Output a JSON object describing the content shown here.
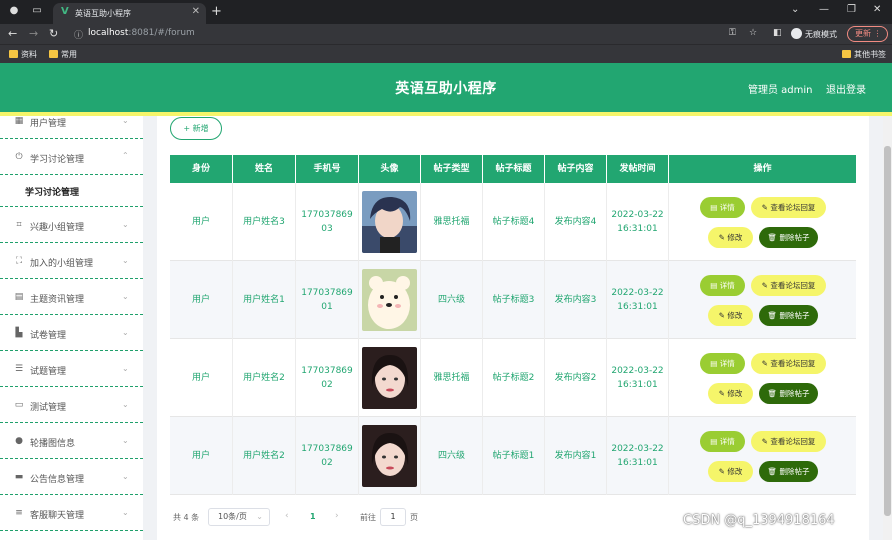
{
  "browser": {
    "tab_title": "英语互助小程序",
    "url_host": "localhost",
    "url_rest": ":8081/#/forum",
    "incognito_label": "无痕模式",
    "update_label": "更新",
    "bookmarks": [
      "资料",
      "常用"
    ],
    "other_bookmarks": "其他书签"
  },
  "header": {
    "title": "英语互助小程序",
    "admin": "管理员 admin",
    "logout": "退出登录"
  },
  "sidebar": {
    "items": [
      {
        "label": "用户管理",
        "icon": "grid-icon"
      },
      {
        "label": "学习讨论管理",
        "icon": "power-icon",
        "expanded": true
      },
      {
        "label": "兴趣小组管理",
        "icon": "crop-icon"
      },
      {
        "label": "加入的小组管理",
        "icon": "frame-icon"
      },
      {
        "label": "主题资讯管理",
        "icon": "clipboard-icon"
      },
      {
        "label": "试卷管理",
        "icon": "chart-icon"
      },
      {
        "label": "试题管理",
        "icon": "sliders-icon"
      },
      {
        "label": "测试管理",
        "icon": "screen-icon"
      },
      {
        "label": "轮播图信息",
        "icon": "user-icon"
      },
      {
        "label": "公告信息管理",
        "icon": "printer-icon"
      },
      {
        "label": "客服聊天管理",
        "icon": "list-icon"
      }
    ],
    "submenu": "学习讨论管理"
  },
  "toolbar": {
    "add_label": "+ 新增"
  },
  "table": {
    "headers": [
      "身份",
      "姓名",
      "手机号",
      "头像",
      "帖子类型",
      "帖子标题",
      "帖子内容",
      "发帖时间",
      "操作"
    ],
    "rows": [
      {
        "role": "用户",
        "name": "用户姓名3",
        "phone": "17703786903",
        "avatar": "anime-boy",
        "type": "雅思托福",
        "title": "帖子标题4",
        "content": "发布内容4",
        "time": "2022-03-22 16:31:01"
      },
      {
        "role": "用户",
        "name": "用户姓名1",
        "phone": "17703786901",
        "avatar": "cartoon-bear",
        "type": "四六级",
        "title": "帖子标题3",
        "content": "发布内容3",
        "time": "2022-03-22 16:31:01"
      },
      {
        "role": "用户",
        "name": "用户姓名2",
        "phone": "17703786902",
        "avatar": "girl-photo",
        "type": "雅思托福",
        "title": "帖子标题2",
        "content": "发布内容2",
        "time": "2022-03-22 16:31:01"
      },
      {
        "role": "用户",
        "name": "用户姓名2",
        "phone": "17703786902",
        "avatar": "girl-photo",
        "type": "四六级",
        "title": "帖子标题1",
        "content": "发布内容1",
        "time": "2022-03-22 16:31:01"
      }
    ],
    "actions": {
      "detail": "详情",
      "reply": "查看论坛回复",
      "edit": "修改",
      "delete": "删除帖子"
    }
  },
  "pagination": {
    "total": "共 4 条",
    "page_size": "10条/页",
    "current": "1",
    "goto_label": "前往",
    "goto_value": "1",
    "page_suffix": "页"
  },
  "watermark": "CSDN @q_1394918164",
  "colors": {
    "primary": "#22a671",
    "accent_yellow": "#f5f56a",
    "detail_green": "#9acd32",
    "delete_dark": "#2e6a0a"
  }
}
